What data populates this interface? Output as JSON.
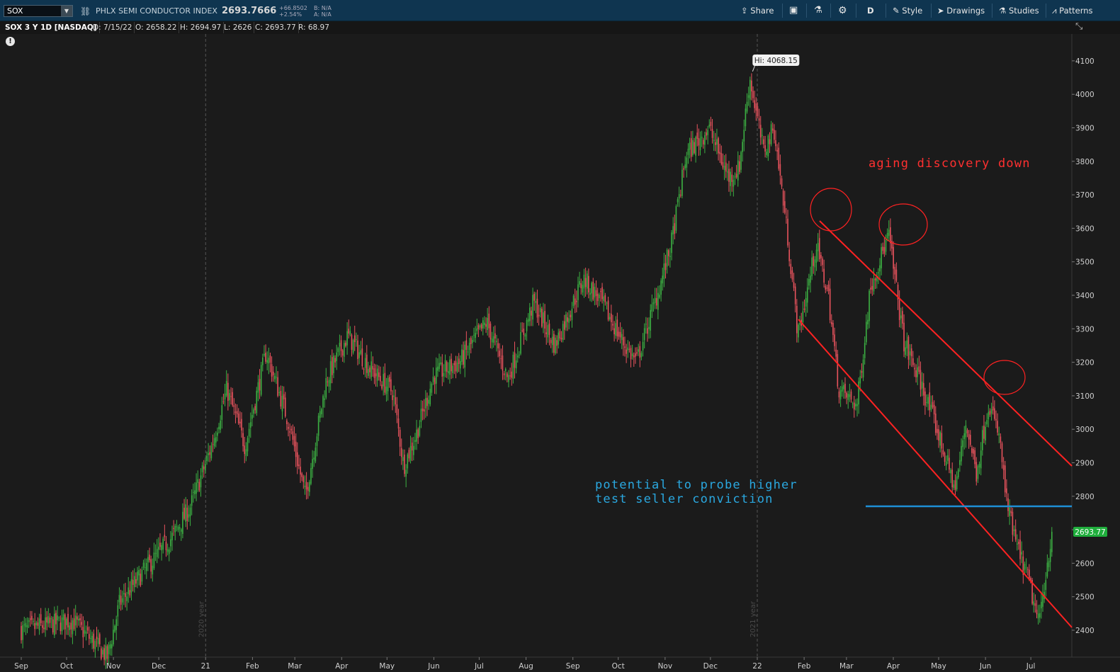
{
  "toolbar": {
    "symbol": "SOX",
    "instrument_name": "PHLX SEMI CONDUCTOR INDEX",
    "last_price": "2693.7666",
    "net_change": "+66.8502",
    "pct_change": "+2.54%",
    "bid": "B: N/A",
    "ask": "A: N/A",
    "share_label": "Share",
    "aggregation_label": "D",
    "style_label": "Style",
    "drawings_label": "Drawings",
    "studies_label": "Studies",
    "patterns_label": "Patterns",
    "icons": [
      "link-icon",
      "share-icon",
      "snapshot-icon",
      "flask-icon",
      "gear-icon",
      "style-icon",
      "cursor-icon",
      "studies-icon",
      "patterns-icon"
    ]
  },
  "infobar": {
    "title": "SOX 3 Y 1D [NASDAQ]",
    "date": "D: 7/15/22",
    "open": "O: 2658.22",
    "high": "H: 2694.97",
    "low": "L: 2626",
    "close": "C: 2693.77",
    "range": "R: 68.97"
  },
  "chart_data": {
    "type": "candlestick",
    "colors": {
      "up": "#3cb043",
      "down": "#e8535d",
      "background": "#1b1b1b",
      "grid": "#555555",
      "current_price": "#1fae3c",
      "trendline": "#ff2222",
      "support": "#1e90d6",
      "annotation_red": "#ff3030",
      "annotation_blue": "#2aa8e0"
    },
    "y_axis": {
      "ticks": [
        2400,
        2500,
        2600,
        2700,
        2800,
        2900,
        3000,
        3100,
        3200,
        3300,
        3400,
        3500,
        3600,
        3700,
        3800,
        3900,
        4000,
        4100
      ],
      "range": [
        2335,
        4160
      ]
    },
    "x_axis": {
      "labels": [
        "Sep",
        "Oct",
        "Nov",
        "Dec",
        "21",
        "Feb",
        "Mar",
        "Apr",
        "May",
        "Jun",
        "Jul",
        "Aug",
        "Sep",
        "Oct",
        "Nov",
        "Dec",
        "22",
        "Feb",
        "Mar",
        "Apr",
        "May",
        "Jun",
        "Jul"
      ]
    },
    "year_markers": [
      "2020 year",
      "2021 year"
    ],
    "high_marker": "Hi: 4068.15",
    "current_price_label": "2693.77",
    "close_path": [
      [
        "2020-09-01",
        2400
      ],
      [
        "2020-10-05",
        2430
      ],
      [
        "2020-10-28",
        2320
      ],
      [
        "2020-11-05",
        2480
      ],
      [
        "2020-11-20",
        2570
      ],
      [
        "2020-12-10",
        2680
      ],
      [
        "2020-12-22",
        2770
      ],
      [
        "2021-01-05",
        2950
      ],
      [
        "2021-01-15",
        3120
      ],
      [
        "2021-01-27",
        2950
      ],
      [
        "2021-02-10",
        3230
      ],
      [
        "2021-02-25",
        3020
      ],
      [
        "2021-03-08",
        2800
      ],
      [
        "2021-03-22",
        3150
      ],
      [
        "2021-04-05",
        3280
      ],
      [
        "2021-04-20",
        3180
      ],
      [
        "2021-05-05",
        3110
      ],
      [
        "2021-05-12",
        2890
      ],
      [
        "2021-05-20",
        2980
      ],
      [
        "2021-06-01",
        3160
      ],
      [
        "2021-06-18",
        3200
      ],
      [
        "2021-07-06",
        3320
      ],
      [
        "2021-07-20",
        3150
      ],
      [
        "2021-08-06",
        3380
      ],
      [
        "2021-08-20",
        3250
      ],
      [
        "2021-09-08",
        3450
      ],
      [
        "2021-09-20",
        3380
      ],
      [
        "2021-10-04",
        3260
      ],
      [
        "2021-10-13",
        3200
      ],
      [
        "2021-10-28",
        3420
      ],
      [
        "2021-11-05",
        3550
      ],
      [
        "2021-11-15",
        3820
      ],
      [
        "2021-11-30",
        3900
      ],
      [
        "2021-12-13",
        3750
      ],
      [
        "2021-12-20",
        3780
      ],
      [
        "2021-12-27",
        4050
      ],
      [
        "2022-01-05",
        3830
      ],
      [
        "2022-01-12",
        3900
      ],
      [
        "2022-01-21",
        3580
      ],
      [
        "2022-01-28",
        3280
      ],
      [
        "2022-02-09",
        3550
      ],
      [
        "2022-02-17",
        3400
      ],
      [
        "2022-02-24",
        3120
      ],
      [
        "2022-03-08",
        3070
      ],
      [
        "2022-03-17",
        3430
      ],
      [
        "2022-03-29",
        3580
      ],
      [
        "2022-04-08",
        3260
      ],
      [
        "2022-04-19",
        3140
      ],
      [
        "2022-04-29",
        3010
      ],
      [
        "2022-05-12",
        2820
      ],
      [
        "2022-05-19",
        3020
      ],
      [
        "2022-05-26",
        2870
      ],
      [
        "2022-06-03",
        3080
      ],
      [
        "2022-06-10",
        2980
      ],
      [
        "2022-06-15",
        2780
      ],
      [
        "2022-06-21",
        2660
      ],
      [
        "2022-06-30",
        2540
      ],
      [
        "2022-07-06",
        2420
      ],
      [
        "2022-07-15",
        2694
      ]
    ],
    "annotations": [
      {
        "text": "aging discovery down"
      },
      {
        "text": "potential to probe higher"
      },
      {
        "text": "test seller conviction"
      }
    ]
  }
}
